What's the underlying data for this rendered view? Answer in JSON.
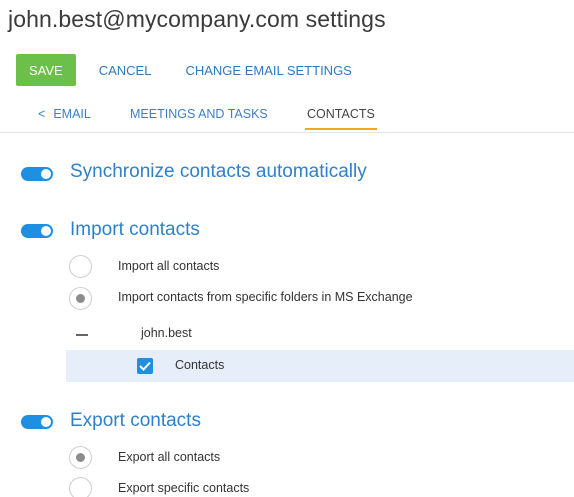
{
  "page": {
    "title": "john.best@mycompany.com settings"
  },
  "toolbar": {
    "save_label": "SAVE",
    "cancel_label": "CANCEL",
    "change_email_label": "CHANGE EMAIL SETTINGS"
  },
  "tabs": [
    {
      "label": "EMAIL",
      "icon": "chevron-left-icon"
    },
    {
      "label": "MEETINGS AND TASKS"
    },
    {
      "label": "CONTACTS",
      "active": true
    }
  ],
  "sections": {
    "sync": {
      "label": "Synchronize contacts automatically",
      "enabled": true
    },
    "import": {
      "label": "Import contacts",
      "enabled": true,
      "options": [
        {
          "label": "Import all contacts",
          "selected": false
        },
        {
          "label": "Import contacts from specific folders in MS Exchange",
          "selected": true
        }
      ],
      "folders": {
        "account": "john.best",
        "expanded": true,
        "children": [
          {
            "label": "Contacts",
            "checked": true
          }
        ]
      }
    },
    "export": {
      "label": "Export contacts",
      "enabled": true,
      "options": [
        {
          "label": "Export all contacts",
          "selected": true
        },
        {
          "label": "Export specific contacts",
          "selected": false
        }
      ]
    }
  },
  "colors": {
    "accent": "#1e8fe1",
    "save": "#6cc04a",
    "link": "#2b78c5",
    "active_tab_underline": "#f5a623",
    "selected_row": "#e6eefa"
  }
}
